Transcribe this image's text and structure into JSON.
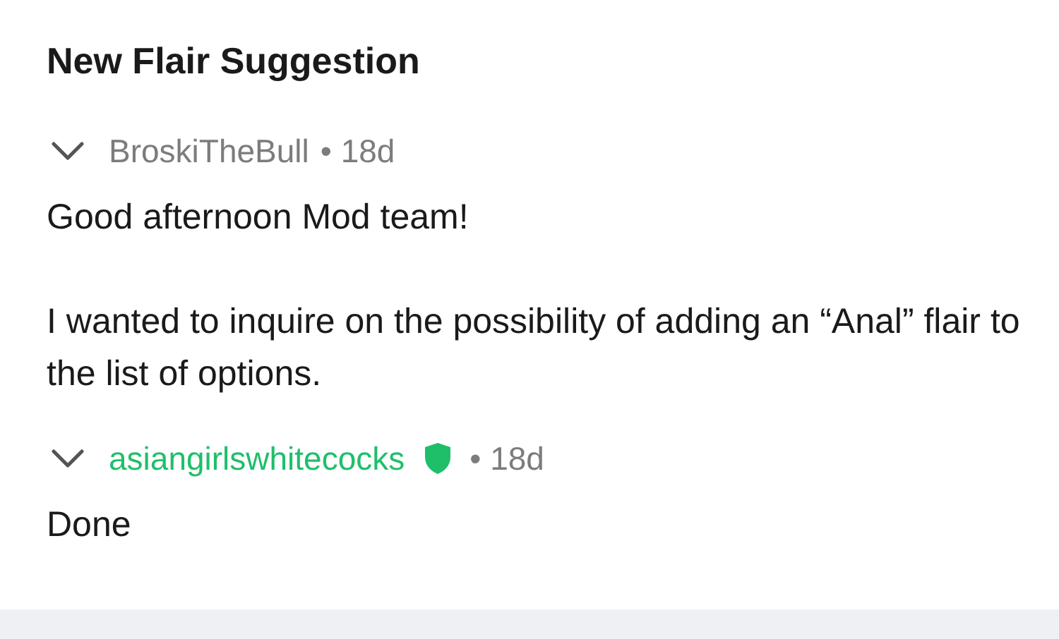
{
  "title": "New Flair Suggestion",
  "comments": [
    {
      "author": "BroskiTheBull",
      "moderator": false,
      "age": "• 18d",
      "expanded": true,
      "body": [
        "Good afternoon Mod team!",
        "I wanted to inquire on the possibility of adding an “Anal” flair to the list of options."
      ]
    },
    {
      "author": "asiangirlswhitecocks",
      "moderator": true,
      "age": "• 18d",
      "expanded": true,
      "body": [
        "Done"
      ]
    }
  ]
}
